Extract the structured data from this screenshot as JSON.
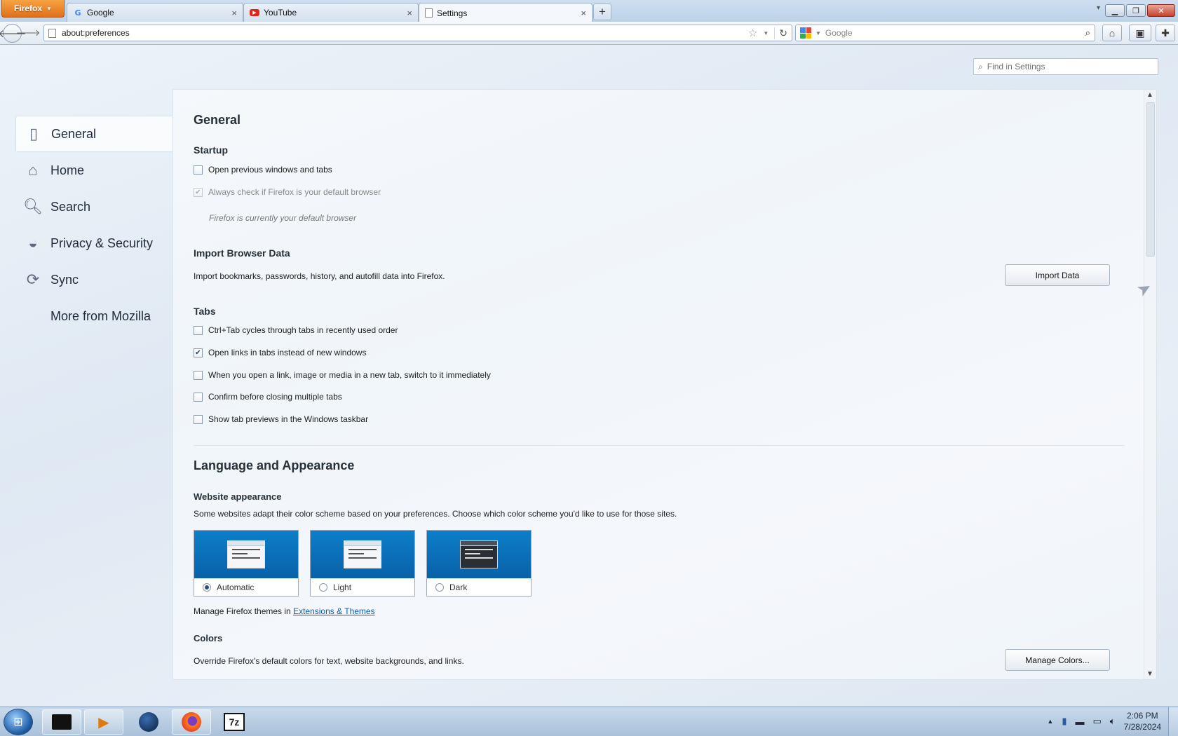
{
  "browser": {
    "menu_button": "Firefox",
    "tabs": [
      {
        "label": "Google",
        "favicon": "google-favicon"
      },
      {
        "label": "YouTube",
        "favicon": "youtube-favicon"
      },
      {
        "label": "Settings",
        "favicon": "page-favicon",
        "active": true
      }
    ],
    "url": "about:preferences",
    "search_placeholder": "Google"
  },
  "settings": {
    "find_placeholder": "Find in Settings",
    "sidebar": [
      {
        "label": "General",
        "icon": "general-icon",
        "active": true
      },
      {
        "label": "Home",
        "icon": "home-icon"
      },
      {
        "label": "Search",
        "icon": "search-icon"
      },
      {
        "label": "Privacy & Security",
        "icon": "mask-icon"
      },
      {
        "label": "Sync",
        "icon": "sync-icon"
      },
      {
        "label": "More from Mozilla",
        "icon": ""
      }
    ],
    "general": {
      "title": "General",
      "startup": {
        "title": "Startup",
        "restore_label": "Open previous windows and tabs",
        "restore_checked": false,
        "default_check_label": "Always check if Firefox is your default browser",
        "default_check_checked": true,
        "default_note": "Firefox is currently your default browser"
      },
      "import": {
        "title": "Import Browser Data",
        "description": "Import bookmarks, passwords, history, and autofill data into Firefox.",
        "button": "Import Data"
      },
      "tabs": {
        "title": "Tabs",
        "options": [
          {
            "label": "Ctrl+Tab cycles through tabs in recently used order",
            "checked": false
          },
          {
            "label": "Open links in tabs instead of new windows",
            "checked": true
          },
          {
            "label": "When you open a link, image or media in a new tab, switch to it immediately",
            "checked": false
          },
          {
            "label": "Confirm before closing multiple tabs",
            "checked": false
          },
          {
            "label": "Show tab previews in the Windows taskbar",
            "checked": false
          }
        ]
      }
    },
    "appearance": {
      "title": "Language and Appearance",
      "website_appearance": {
        "title": "Website appearance",
        "description": "Some websites adapt their color scheme based on your preferences. Choose which color scheme you'd like to use for those sites.",
        "options": [
          {
            "label": "Automatic",
            "selected": true
          },
          {
            "label": "Light",
            "selected": false
          },
          {
            "label": "Dark",
            "selected": false
          }
        ],
        "themes_prefix": "Manage Firefox themes in",
        "themes_link": "Extensions & Themes"
      },
      "colors": {
        "title": "Colors",
        "description": "Override Firefox's default colors for text, website backgrounds, and links.",
        "button": "Manage Colors..."
      }
    }
  },
  "taskbar": {
    "apps": [
      "terminal-app",
      "media-player-app",
      "globe-app",
      "firefox-app",
      "7zip-app"
    ],
    "app_7zip_label": "7z",
    "time": "2:06 PM",
    "date": "7/28/2024"
  },
  "colors": {
    "accent": "#e0701a",
    "link": "#0a5fb4",
    "theme_blue": "#0861a8"
  }
}
